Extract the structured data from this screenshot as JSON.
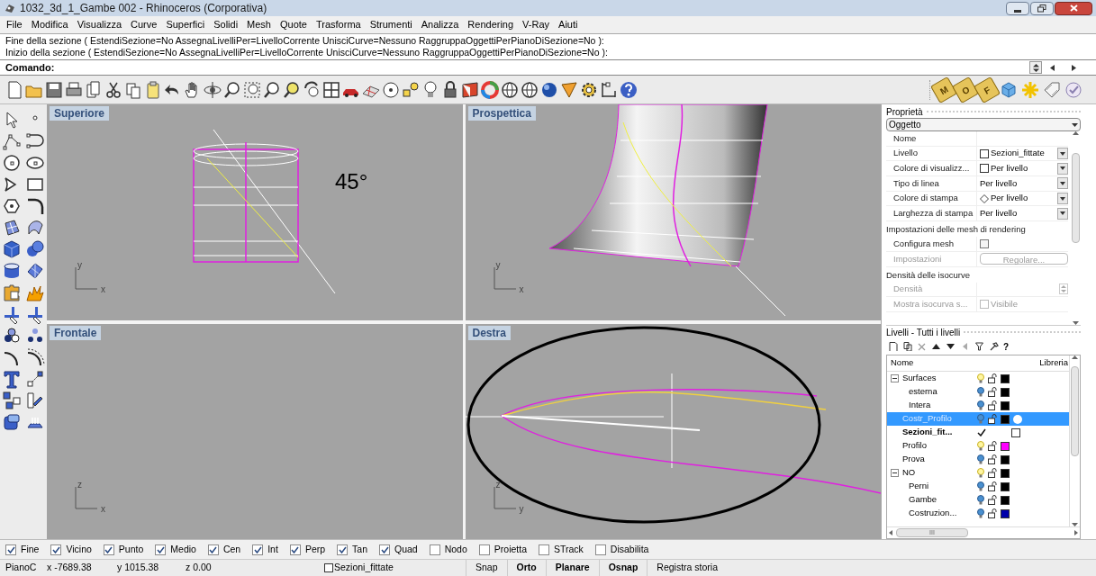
{
  "window": {
    "title": "1032_3d_1_Gambe 002 - Rhinoceros (Corporativa)"
  },
  "menu": [
    "File",
    "Modifica",
    "Visualizza",
    "Curve",
    "Superfici",
    "Solidi",
    "Mesh",
    "Quote",
    "Trasforma",
    "Strumenti",
    "Analizza",
    "Rendering",
    "V-Ray",
    "Aiuti"
  ],
  "command_history": [
    "Fine della sezione ( EstendiSezione=No  AssegnaLivelliPer=LivelloCorrente  UnisciCurve=Nessuno  RaggruppaOggettiPerPianoDiSezione=No ):",
    "Inizio della sezione ( EstendiSezione=No  AssegnaLivelliPer=LivelloCorrente  UnisciCurve=Nessuno  RaggruppaOggettiPerPianoDiSezione=No ):"
  ],
  "command_prompt": "Comando:",
  "tag_tools": [
    "M",
    "O",
    "F"
  ],
  "viewports": [
    {
      "title": "Superiore",
      "kind": "top",
      "axes": [
        "y",
        "x"
      ],
      "annotation": "45°"
    },
    {
      "title": "Prospettica",
      "kind": "perspective",
      "axes": [
        "y",
        "x"
      ]
    },
    {
      "title": "Frontale",
      "kind": "front",
      "axes": [
        "z",
        "x"
      ]
    },
    {
      "title": "Destra",
      "kind": "right",
      "axes": [
        "z",
        "y"
      ]
    }
  ],
  "properties": {
    "title": "Proprietà",
    "selector": "Oggetto",
    "rows": [
      {
        "kind": "text",
        "label": "Nome"
      },
      {
        "kind": "swatch",
        "label": "Livello",
        "value": "Sezioni_fittate"
      },
      {
        "kind": "swatch",
        "label": "Colore di visualizz...",
        "value": "Per livello"
      },
      {
        "kind": "plain",
        "label": "Tipo di linea",
        "value": "Per livello"
      },
      {
        "kind": "diamond",
        "label": "Colore di stampa",
        "value": "Per livello"
      },
      {
        "kind": "plain",
        "label": "Larghezza di stampa",
        "value": "Per livello"
      }
    ],
    "sections": [
      {
        "title": "Impostazioni delle mesh di rendering",
        "rows": [
          {
            "kind": "checkbox",
            "label": "Configura mesh",
            "checked": false,
            "disabled": false
          },
          {
            "kind": "button",
            "label": "Impostazioni",
            "value": "Regolare...",
            "disabled": true
          }
        ]
      },
      {
        "title": "Densità delle isocurve",
        "rows": [
          {
            "kind": "spinner",
            "label": "Densità",
            "disabled": true
          },
          {
            "kind": "checkbox",
            "label": "Mostra isocurva s...",
            "value": "Visibile",
            "checked": false,
            "disabled": true
          }
        ]
      }
    ]
  },
  "layers": {
    "title": "Livelli - Tutti i livelli",
    "help": "?",
    "columns": [
      "Nome",
      "Libreria"
    ],
    "rows": [
      {
        "name": "Surfaces",
        "expanded": true,
        "current": false,
        "selected": false,
        "lit": true,
        "color": "#000000",
        "children": [
          {
            "name": "esterna",
            "current": false,
            "selected": false,
            "lit": false,
            "color": "#000000"
          },
          {
            "name": "Intera",
            "current": false,
            "selected": false,
            "lit": false,
            "color": "#000000"
          }
        ]
      },
      {
        "name": "Costr_Profilo",
        "current": false,
        "selected": true,
        "lit": false,
        "color": "#000000"
      },
      {
        "name": "Sezioni_fit...",
        "current": true,
        "selected": false,
        "color": "#ffffff"
      },
      {
        "name": "Profilo",
        "current": false,
        "selected": false,
        "lit": true,
        "color": "#ff00ff"
      },
      {
        "name": "Prova",
        "current": false,
        "selected": false,
        "lit": false,
        "color": "#000000"
      },
      {
        "name": "NO",
        "expanded": true,
        "current": false,
        "selected": false,
        "lit": true,
        "color": "#000000",
        "children": [
          {
            "name": "Perni",
            "current": false,
            "selected": false,
            "lit": false,
            "color": "#000000"
          },
          {
            "name": "Gambe",
            "current": false,
            "selected": false,
            "lit": false,
            "color": "#000000"
          },
          {
            "name": "Costruzion...",
            "current": false,
            "selected": false,
            "lit": false,
            "color": "#0000aa"
          }
        ]
      }
    ],
    "scroll_mark": "III"
  },
  "osnaps": [
    {
      "label": "Fine",
      "checked": true
    },
    {
      "label": "Vicino",
      "checked": true
    },
    {
      "label": "Punto",
      "checked": true
    },
    {
      "label": "Medio",
      "checked": true
    },
    {
      "label": "Cen",
      "checked": true
    },
    {
      "label": "Int",
      "checked": true
    },
    {
      "label": "Perp",
      "checked": true
    },
    {
      "label": "Tan",
      "checked": true
    },
    {
      "label": "Quad",
      "checked": true
    },
    {
      "label": "Nodo",
      "checked": false
    },
    {
      "label": "Proietta",
      "checked": false
    },
    {
      "label": "STrack",
      "checked": false
    },
    {
      "label": "Disabilita",
      "checked": false
    }
  ],
  "status_bar": {
    "plane": "PianoC",
    "x": "x -7689.38",
    "y": "y 1015.38",
    "z": "z 0.00",
    "layer": "Sezioni_fittate",
    "toggles": [
      {
        "label": "Snap",
        "on": false
      },
      {
        "label": "Orto",
        "on": true
      },
      {
        "label": "Planare",
        "on": true
      },
      {
        "label": "Osnap",
        "on": true
      },
      {
        "label": "Registra storia",
        "on": false
      }
    ]
  }
}
